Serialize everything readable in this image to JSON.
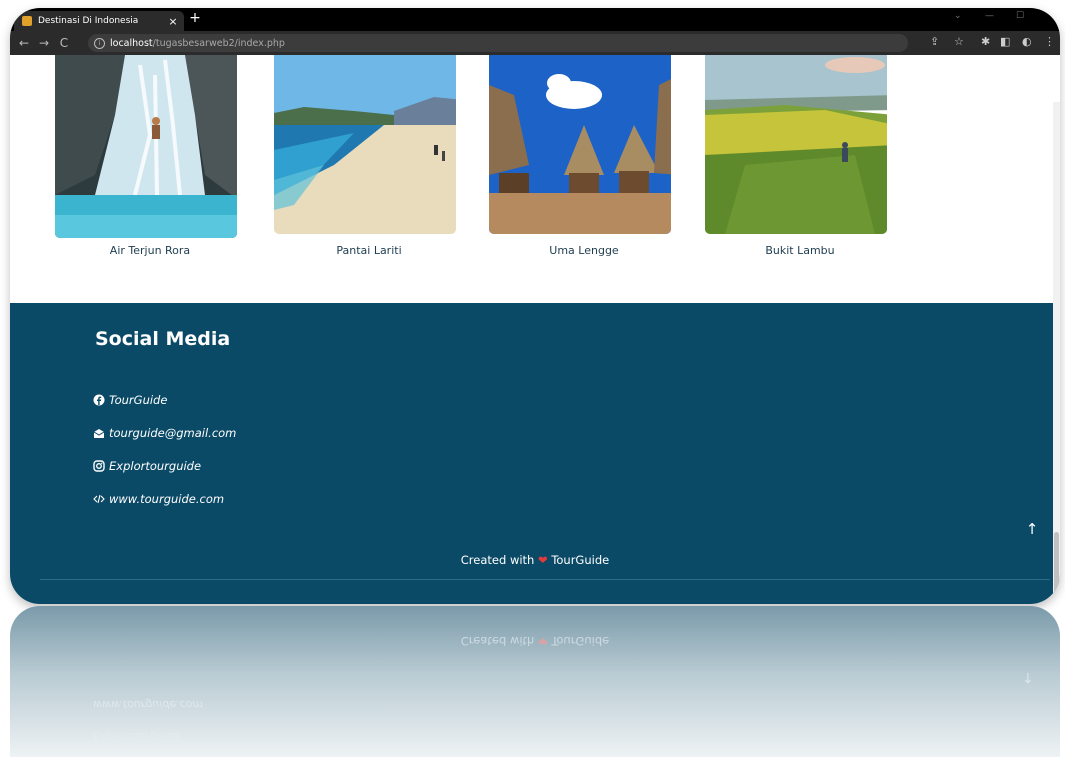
{
  "browser": {
    "tab_title": "Destinasi Di Indonesia",
    "tab_close": "×",
    "new_tab": "+",
    "url_host": "localhost",
    "url_path": "/tugasbesarweb2/index.php"
  },
  "destinations": [
    {
      "name": "Air Terjun Rora"
    },
    {
      "name": "Pantai Lariti"
    },
    {
      "name": "Uma Lengge"
    },
    {
      "name": "Bukit Lambu"
    }
  ],
  "footer": {
    "heading": "Social Media",
    "links": [
      {
        "icon": "facebook-icon",
        "text": "TourGuide"
      },
      {
        "icon": "email-icon",
        "text": "tourguide@gmail.com"
      },
      {
        "icon": "instagram-icon",
        "text": "Explortourguide"
      },
      {
        "icon": "code-icon",
        "text": "www.tourguide.com"
      }
    ],
    "credit_prefix": "Created with",
    "credit_suffix": "TourGuide",
    "back_to_top": "↑"
  },
  "colors": {
    "footer_bg": "#0b4a66",
    "heart": "#e33a3a",
    "label": "#1e3d4f"
  }
}
